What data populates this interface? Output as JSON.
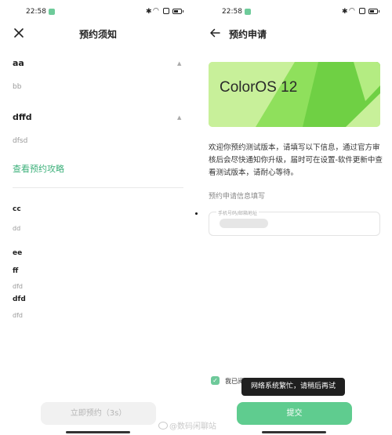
{
  "status_bar": {
    "time": "22:58"
  },
  "left": {
    "title": "预约须知",
    "sections": [
      {
        "title": "aa",
        "body": "bb"
      },
      {
        "title": "dffd",
        "body": "dfsd"
      }
    ],
    "guide_link": "查看预约攻略",
    "items": [
      {
        "title": "cc",
        "body": "dd"
      },
      {
        "title": "ee",
        "body": ""
      },
      {
        "title": "ff",
        "body": "dfd"
      },
      {
        "title": "dfd",
        "body": "dfd"
      }
    ],
    "reserve_button": "立即预约（3s）"
  },
  "right": {
    "title": "预约申请",
    "banner_text": "ColorOS 12",
    "intro": "欢迎你预约测试版本，请填写以下信息，通过官方审核后会尽快通知你升级，届时可在设置-软件更新中查看测试版本，请耐心等待。",
    "form_label": "预约申请信息填写",
    "input_label": "手机号码/邮箱地址",
    "agree_text": "我已阅",
    "toast": "网络系统繁忙，请稍后再试",
    "submit_button": "提交"
  },
  "watermark": "@数码闲聊站",
  "colors": {
    "accent": "#5fcc8f",
    "link": "#3cb07a",
    "banner": "#c8f09a"
  }
}
